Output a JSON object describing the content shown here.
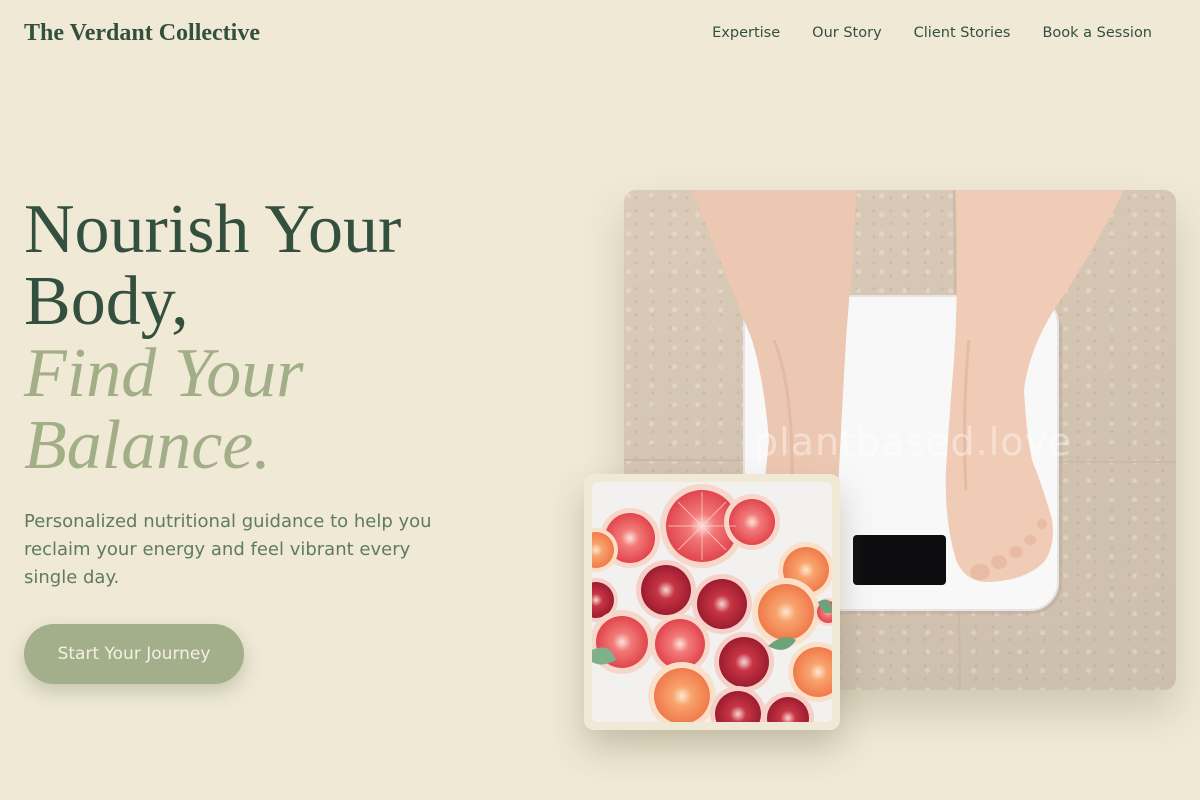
{
  "header": {
    "brand": "The Verdant Collective",
    "nav": [
      "Expertise",
      "Our Story",
      "Client Stories",
      "Book a Session"
    ]
  },
  "hero": {
    "headline_line1": "Nourish Your",
    "headline_line2": "Body,",
    "headline_accent_line1": "Find Your",
    "headline_accent_line2": "Balance.",
    "subtext": "Personalized nutritional guidance to help you reclaim your energy and feel vibrant every single day.",
    "cta_label": "Start Your Journey"
  },
  "images": {
    "main_watermark": "plantbased.love",
    "main_subject": "feet on bathroom scale",
    "inset_subject": "sliced grapefruit and blood oranges"
  },
  "colors": {
    "background": "#efe9d5",
    "primary_text": "#33503f",
    "accent_sage": "#a2ae86",
    "subtext": "#5f7b62",
    "cta_background": "#a3ae8a"
  }
}
